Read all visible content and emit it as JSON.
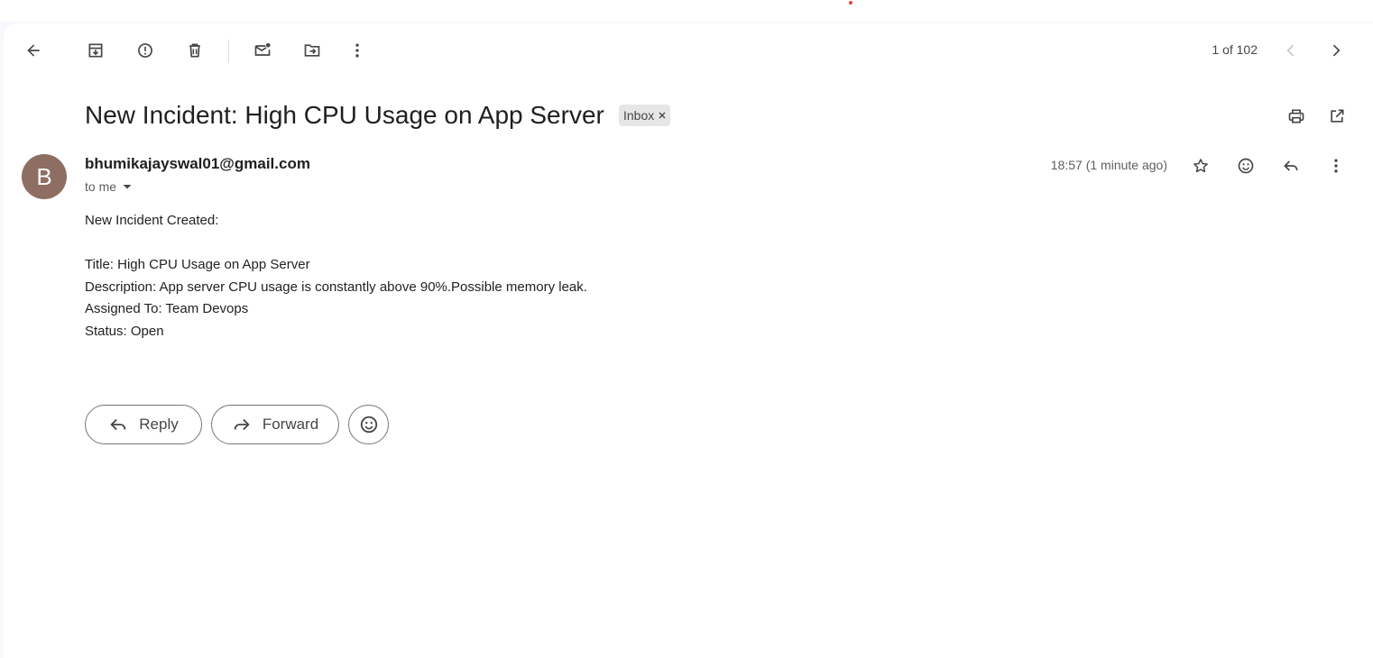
{
  "toolbar": {
    "back_icon": "arrow-left-icon",
    "archive_icon": "archive-icon",
    "report_spam_icon": "report-spam-icon",
    "delete_icon": "trash-icon",
    "mark_unread_icon": "mark-unread-icon",
    "move_to_icon": "move-to-folder-icon",
    "more_icon": "more-vertical-icon",
    "pager": "1 of 102",
    "newer_icon": "chevron-left-icon",
    "older_icon": "chevron-right-icon"
  },
  "email": {
    "subject": "New Incident: High CPU Usage on App Server",
    "label": "Inbox",
    "sender": "bhumikajayswal01@gmail.com",
    "avatar_letter": "B",
    "avatar_color": "#8e6e62",
    "recipient": "to me",
    "timestamp": "18:57 (1 minute ago)",
    "body": {
      "intro": "New Incident Created:",
      "title": "Title: High CPU Usage on App Server",
      "description": "Description: App server CPU usage is constantly above 90%.Possible memory leak.",
      "assigned": "Assigned To: Team Devops",
      "status": "Status: Open"
    }
  },
  "actions": {
    "reply": "Reply",
    "forward": "Forward"
  },
  "colors": {
    "accent_red": "#ea4335",
    "icon_gray": "#444746",
    "chip_bg": "#e6e6e6"
  }
}
